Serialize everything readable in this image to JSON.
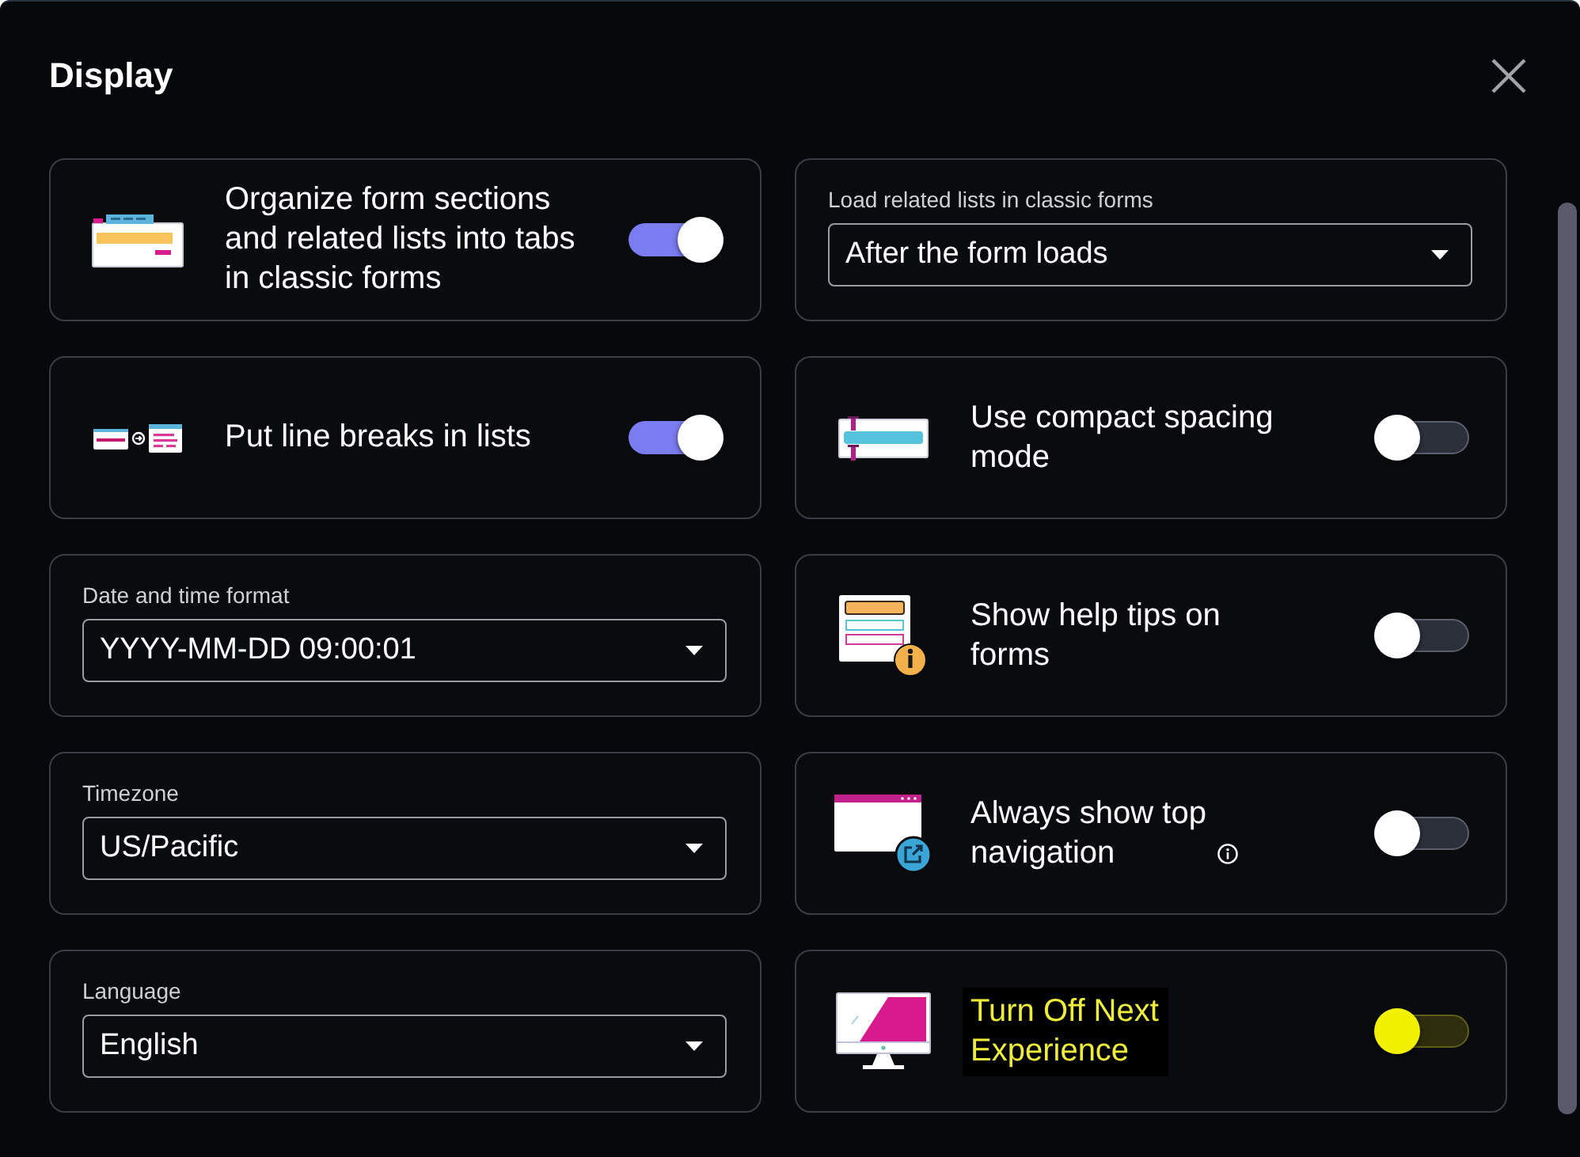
{
  "window": {
    "title": "Display"
  },
  "left_column": [
    {
      "kind": "toggle",
      "label": "Organize form sections and related lists into tabs in classic forms",
      "on": true,
      "highlighted": false,
      "info_icon": false
    },
    {
      "kind": "toggle",
      "label": "Put line breaks in lists",
      "on": true,
      "highlighted": false,
      "info_icon": false
    },
    {
      "kind": "select",
      "label": "Date and time format",
      "value": "YYYY-MM-DD 09:00:01"
    },
    {
      "kind": "select",
      "label": "Timezone",
      "value": "US/Pacific"
    },
    {
      "kind": "select",
      "label": "Language",
      "value": "English"
    }
  ],
  "right_column": [
    {
      "kind": "select",
      "label": "Load related lists in classic forms",
      "value": "After the form loads"
    },
    {
      "kind": "toggle",
      "label": "Use compact spacing mode",
      "on": false,
      "highlighted": false,
      "info_icon": false
    },
    {
      "kind": "toggle",
      "label": "Show help tips on forms",
      "on": false,
      "highlighted": false,
      "info_icon": false
    },
    {
      "kind": "toggle",
      "label": "Always show top navigation",
      "on": false,
      "highlighted": false,
      "info_icon": true
    },
    {
      "kind": "toggle",
      "label": "Turn Off Next Experience",
      "on": false,
      "highlighted": true,
      "info_icon": false
    }
  ]
}
